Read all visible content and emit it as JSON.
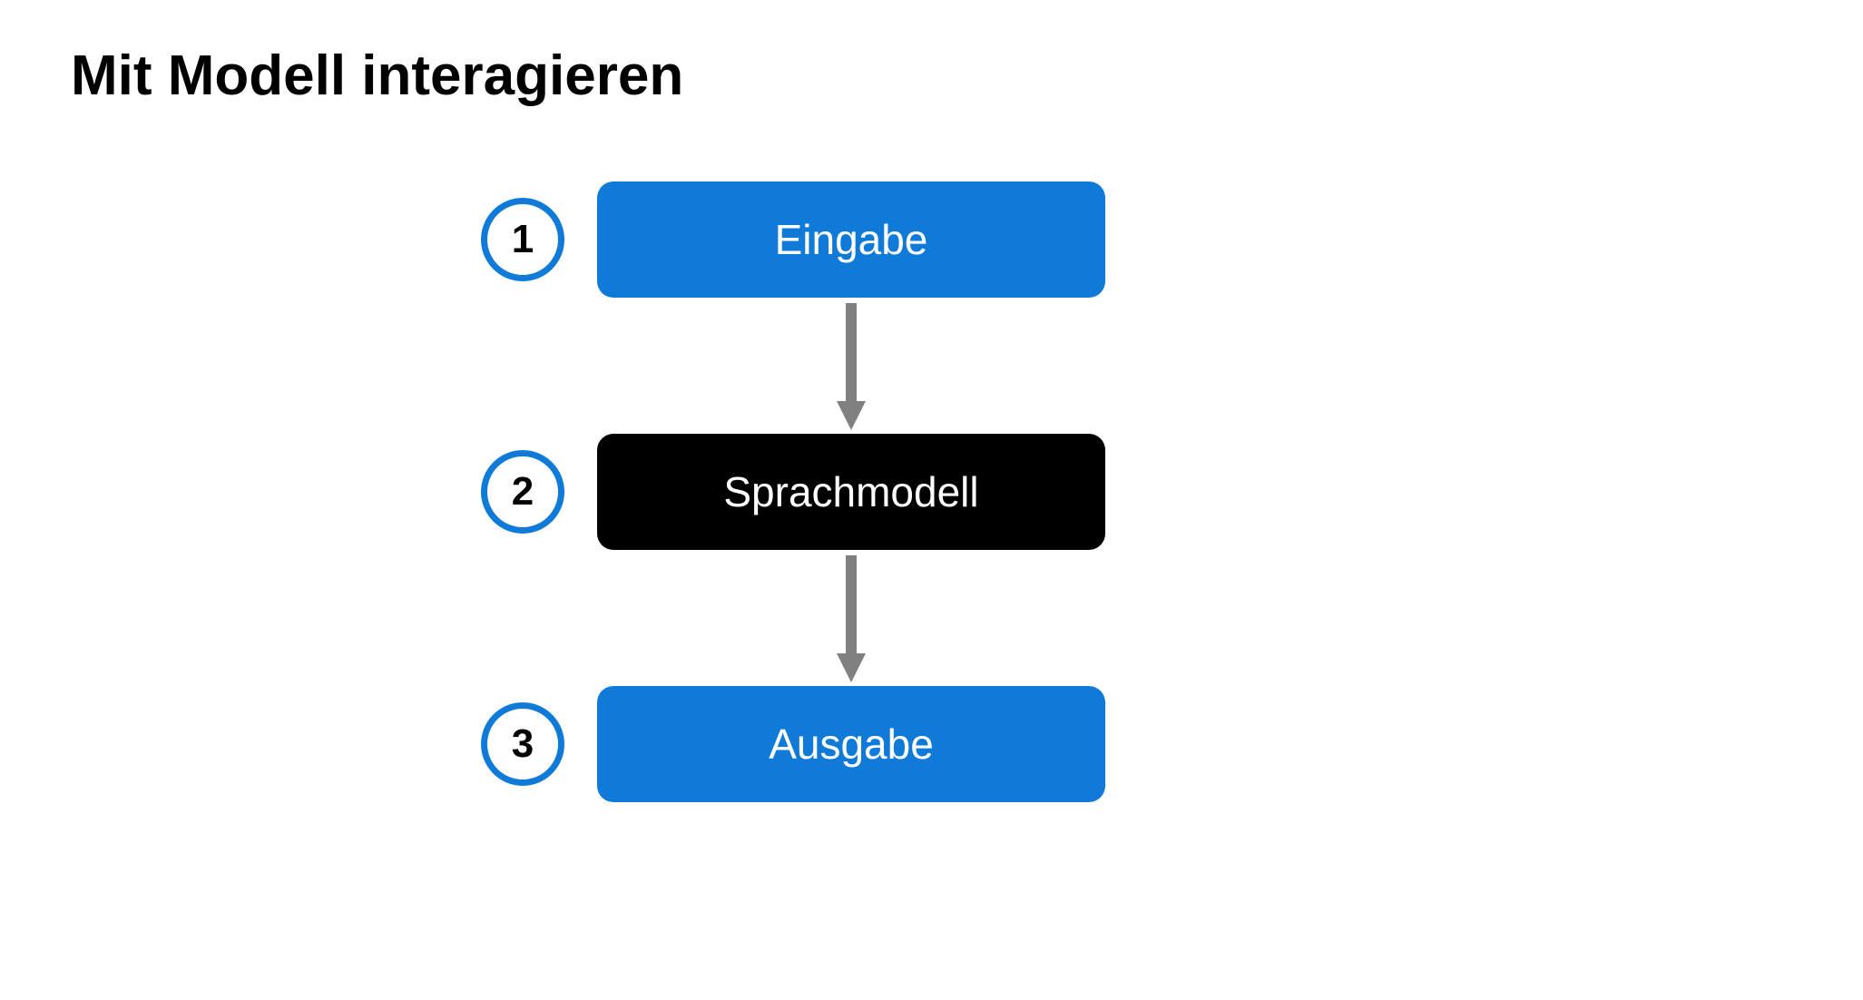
{
  "title": "Mit Modell interagieren",
  "colors": {
    "accent": "#0f7ad8",
    "black": "#000000",
    "arrow": "#808080"
  },
  "steps": [
    {
      "num": "1",
      "label": "Eingabe",
      "style": "blue"
    },
    {
      "num": "2",
      "label": "Sprachmodell",
      "style": "black"
    },
    {
      "num": "3",
      "label": "Ausgabe",
      "style": "blue"
    }
  ]
}
